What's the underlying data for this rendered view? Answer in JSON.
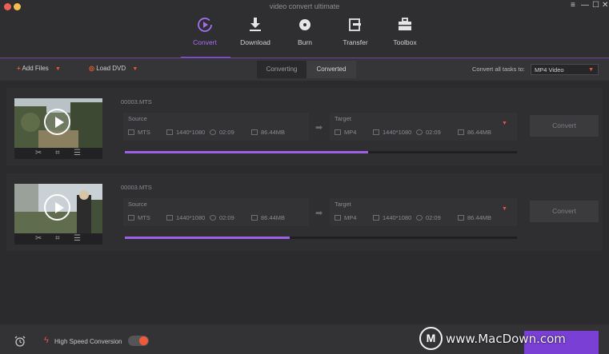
{
  "window": {
    "title": "video convert ultimate",
    "controls": [
      "≡",
      "—",
      "☐",
      "✕"
    ]
  },
  "nav": {
    "items": [
      {
        "label": "Convert",
        "icon": "convert-icon",
        "active": true
      },
      {
        "label": "Download",
        "icon": "download-icon",
        "active": false
      },
      {
        "label": "Burn",
        "icon": "burn-icon",
        "active": false
      },
      {
        "label": "Transfer",
        "icon": "transfer-icon",
        "active": false
      },
      {
        "label": "Toolbox",
        "icon": "toolbox-icon",
        "active": false
      }
    ]
  },
  "toolbar": {
    "add_files": "Add Files",
    "load_dvd": "Load DVD",
    "tabs": [
      "Converting",
      "Converted"
    ],
    "convert_all_label": "Convert all tasks to:",
    "format_value": "MP4 Video"
  },
  "files": [
    {
      "name": "00003.MTS",
      "source": {
        "label": "Source",
        "format": "MTS",
        "resolution": "1440*1080",
        "duration": "02:09",
        "size": "86.44MB"
      },
      "target": {
        "label": "Target",
        "format": "MP4",
        "resolution": "1440*1080",
        "duration": "02:09",
        "size": "86.44MB"
      },
      "convert_label": "Convert",
      "progress": 0.62
    },
    {
      "name": "00003.MTS",
      "source": {
        "label": "Source",
        "format": "MTS",
        "resolution": "1440*1080",
        "duration": "02:09",
        "size": "86.44MB"
      },
      "target": {
        "label": "Target",
        "format": "MP4",
        "resolution": "1440*1080",
        "duration": "02:09",
        "size": "86.44MB"
      },
      "convert_label": "Convert",
      "progress": 0.42
    }
  ],
  "footer": {
    "high_speed_label": "High Speed Conversion",
    "watermark": "www.MacDown.com",
    "watermark_logo": "M"
  },
  "colors": {
    "accent": "#8e52e6",
    "orange": "#e85b30",
    "red": "#e8504a"
  }
}
